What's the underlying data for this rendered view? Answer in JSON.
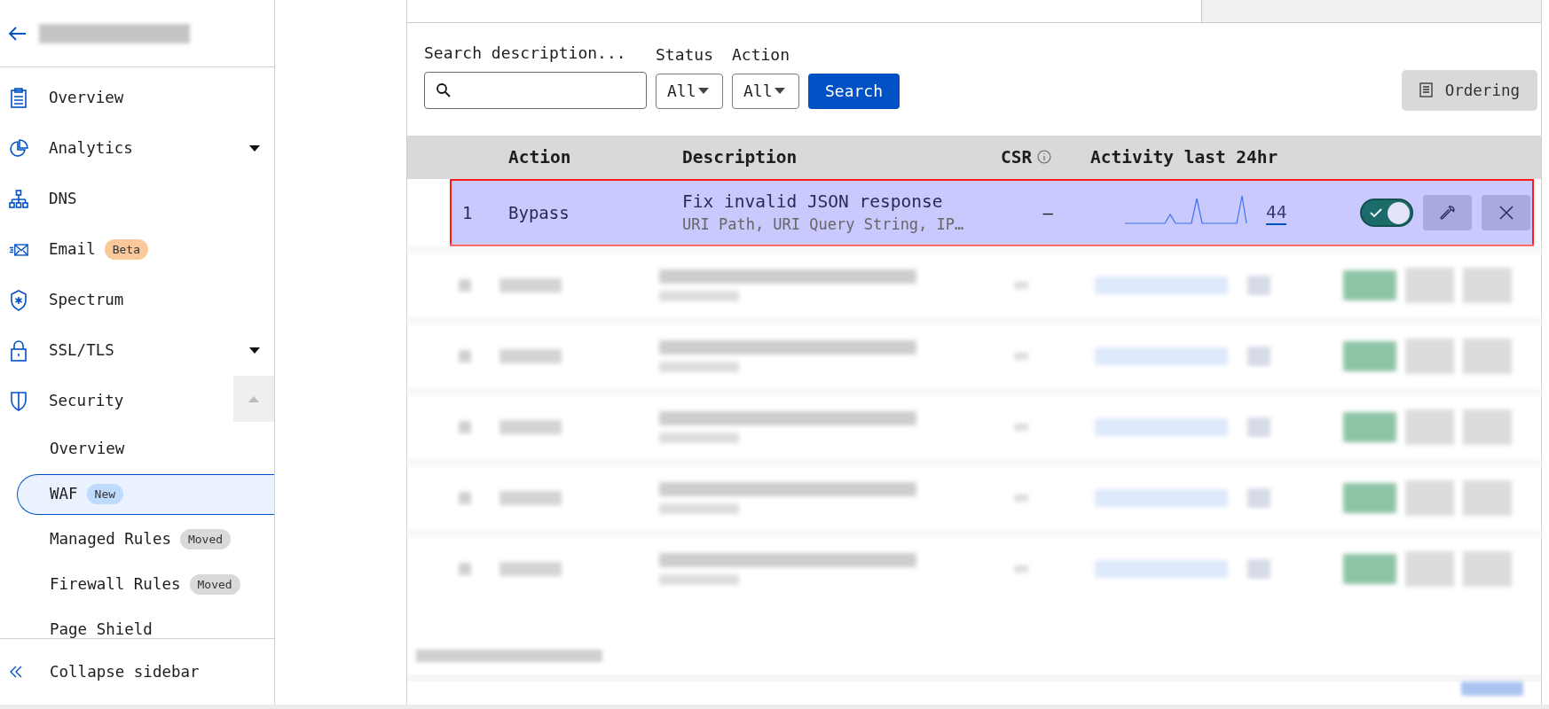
{
  "sidebar": {
    "items": [
      {
        "label": "Overview",
        "selected": false
      },
      {
        "label": "Analytics",
        "expanded": false,
        "selected": false
      },
      {
        "label": "DNS",
        "selected": false
      },
      {
        "label": "Email",
        "badge": {
          "text": "Beta",
          "color": "#f9c89b"
        },
        "selected": false
      },
      {
        "label": "Spectrum",
        "selected": false
      },
      {
        "label": "SSL/TLS",
        "expanded": false,
        "selected": false
      },
      {
        "label": "Security",
        "expanded": true,
        "selected": false,
        "children": [
          {
            "label": "Overview",
            "selected": false
          },
          {
            "label": "WAF",
            "badge": {
              "text": "New",
              "color": "#bfdbfe"
            },
            "selected": true
          },
          {
            "label": "Managed Rules",
            "badge": {
              "text": "Moved",
              "color": "#d9d9d9"
            },
            "selected": false
          },
          {
            "label": "Firewall Rules",
            "badge": {
              "text": "Moved",
              "color": "#d9d9d9"
            },
            "selected": false
          },
          {
            "label": "Page Shield",
            "selected": false
          }
        ]
      }
    ],
    "collapse": "Collapse sidebar"
  },
  "filters": {
    "search_label": "Search description...",
    "status_label": "Status",
    "status_value": "All",
    "action_label": "Action",
    "action_value": "All",
    "search_button": "Search",
    "ordering_button": "Ordering"
  },
  "table": {
    "columns": [
      "Action",
      "Description",
      "CSR",
      "Activity last 24hr"
    ],
    "rows": [
      {
        "kind": "rule",
        "number": "1",
        "action": "Bypass",
        "description": "Fix invalid JSON response",
        "detail": "URI Path, URI Query String, IP…",
        "csr": "–",
        "count": "44",
        "on": true,
        "highlighted": true
      },
      {
        "kind": "redacted"
      },
      {
        "kind": "redacted"
      },
      {
        "kind": "redacted"
      },
      {
        "kind": "redacted"
      },
      {
        "kind": "redacted"
      }
    ]
  }
}
